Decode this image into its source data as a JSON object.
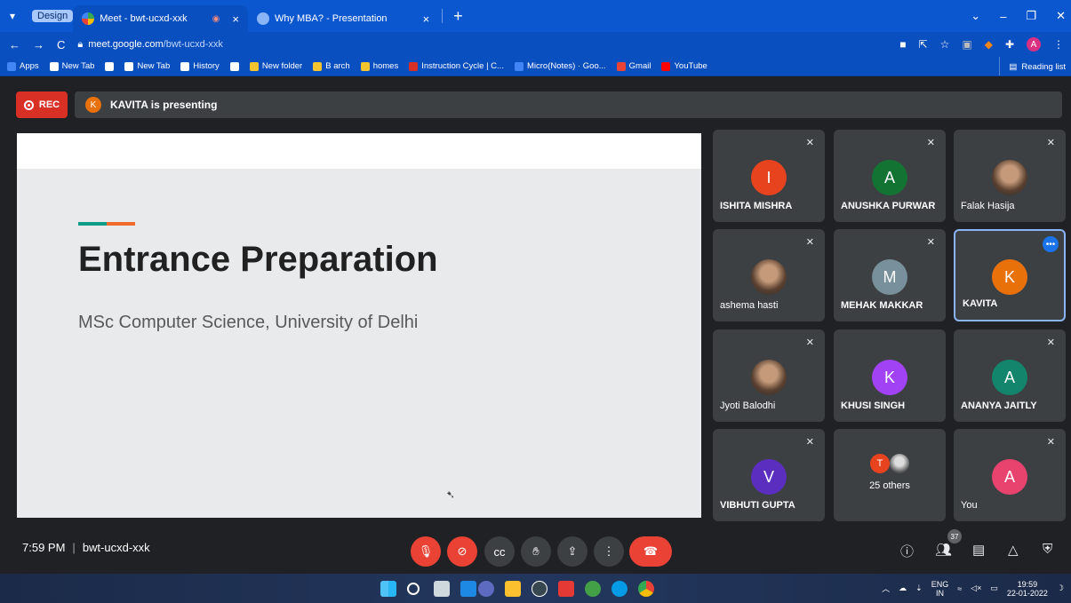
{
  "browser": {
    "group_label": "Design",
    "tabs": [
      {
        "title": "Meet - bwt-ucxd-xxk",
        "active": true
      },
      {
        "title": "Why MBA? - Presentation",
        "active": false
      }
    ],
    "url_host": "meet.google.com",
    "url_path": "/bwt-ucxd-xxk",
    "profile_initial": "A",
    "bookmarks": [
      {
        "label": "Apps",
        "icon": "apps-grid-icon",
        "color": "#4285f4"
      },
      {
        "label": "New Tab",
        "icon": "chrome-icon",
        "color": "#ffffff"
      },
      {
        "label": "",
        "icon": "chrome-icon",
        "color": "#ffffff"
      },
      {
        "label": "New Tab",
        "icon": "google-icon",
        "color": "#ffffff"
      },
      {
        "label": "History",
        "icon": "history-icon",
        "color": "#ffffff"
      },
      {
        "label": "",
        "icon": "google-icon",
        "color": "#ffffff"
      },
      {
        "label": "New folder",
        "icon": "folder-icon",
        "color": "#f4c430"
      },
      {
        "label": "B arch",
        "icon": "folder-icon",
        "color": "#f4c430"
      },
      {
        "label": "homes",
        "icon": "folder-icon",
        "color": "#f4c430"
      },
      {
        "label": "Instruction Cycle | C...",
        "icon": "v-logo-icon",
        "color": "#d93025"
      },
      {
        "label": "Micro(Notes) · Goo...",
        "icon": "docs-icon",
        "color": "#4285f4"
      },
      {
        "label": "Gmail",
        "icon": "gmail-icon",
        "color": "#ea4335"
      },
      {
        "label": "YouTube",
        "icon": "youtube-icon",
        "color": "#ff0000"
      }
    ],
    "reading_list": "Reading list"
  },
  "meet": {
    "rec_label": "REC",
    "presenter_initial": "K",
    "presenting_text": "KAVITA is presenting",
    "slide": {
      "title": "Entrance Preparation",
      "subtitle": "MSc Computer Science, University of Delhi"
    },
    "participants": [
      {
        "name": "ISHITA MISHRA",
        "initial": "I",
        "color": "#e8431f",
        "photo": false,
        "muted": true
      },
      {
        "name": "ANUSHKA PURWAR",
        "initial": "A",
        "color": "#137333",
        "photo": false,
        "muted": true
      },
      {
        "name": "Falak Hasija",
        "initial": "",
        "color": "",
        "photo": true,
        "muted": true
      },
      {
        "name": "ashema hasti",
        "initial": "",
        "color": "",
        "photo": true,
        "muted": true
      },
      {
        "name": "MEHAK MAKKAR",
        "initial": "M",
        "color": "#78909c",
        "photo": false,
        "muted": true
      },
      {
        "name": "KAVITA",
        "initial": "K",
        "color": "#e8710a",
        "photo": false,
        "muted": false,
        "selected": true
      },
      {
        "name": "Jyoti Balodhi",
        "initial": "",
        "color": "",
        "photo": true,
        "muted": true
      },
      {
        "name": "KHUSI SINGH",
        "initial": "K",
        "color": "#a142f4",
        "photo": false,
        "muted": false
      },
      {
        "name": "ANANYA JAITLY",
        "initial": "A",
        "color": "#12856c",
        "photo": false,
        "muted": true
      },
      {
        "name": "VIBHUTI GUPTA",
        "initial": "V",
        "color": "#5b2ebf",
        "photo": false,
        "muted": true
      },
      {
        "name": "",
        "others": "25 others",
        "initial": "T",
        "color": "#e8431f"
      },
      {
        "name": "You",
        "initial": "A",
        "color": "#e8436f",
        "photo": false,
        "muted": true
      }
    ],
    "time": "7:59 PM",
    "meeting_code": "bwt-ucxd-xxk",
    "people_count": "37"
  },
  "taskbar": {
    "lang_top": "ENG",
    "lang_bottom": "IN",
    "clock_time": "19:59",
    "clock_date": "22-01-2022"
  }
}
